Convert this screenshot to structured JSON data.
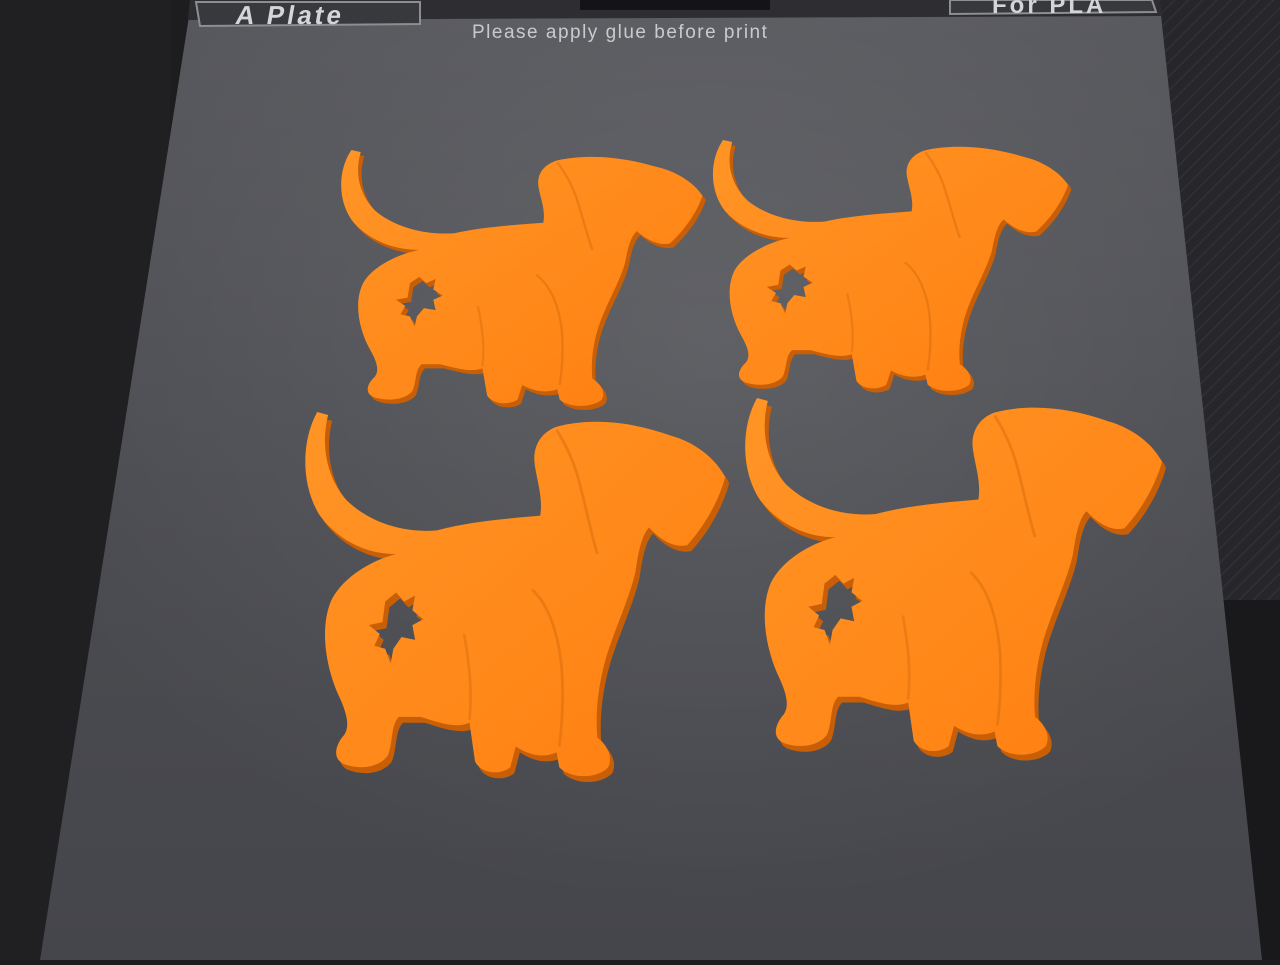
{
  "plate": {
    "name": "A Plate",
    "material": "For PLA",
    "note": "Please apply glue before print"
  },
  "colors": {
    "plate_surface": "#4a4b50",
    "plate_frame": "#2b2b2f",
    "print_orange": "#ff8a1a",
    "print_shadow": "#d96a08",
    "label_text": "#cfd0d3"
  },
  "prints": [
    {
      "item": "dachshund-coaster"
    },
    {
      "item": "dachshund-coaster"
    },
    {
      "item": "dachshund-coaster"
    },
    {
      "item": "dachshund-coaster"
    }
  ]
}
